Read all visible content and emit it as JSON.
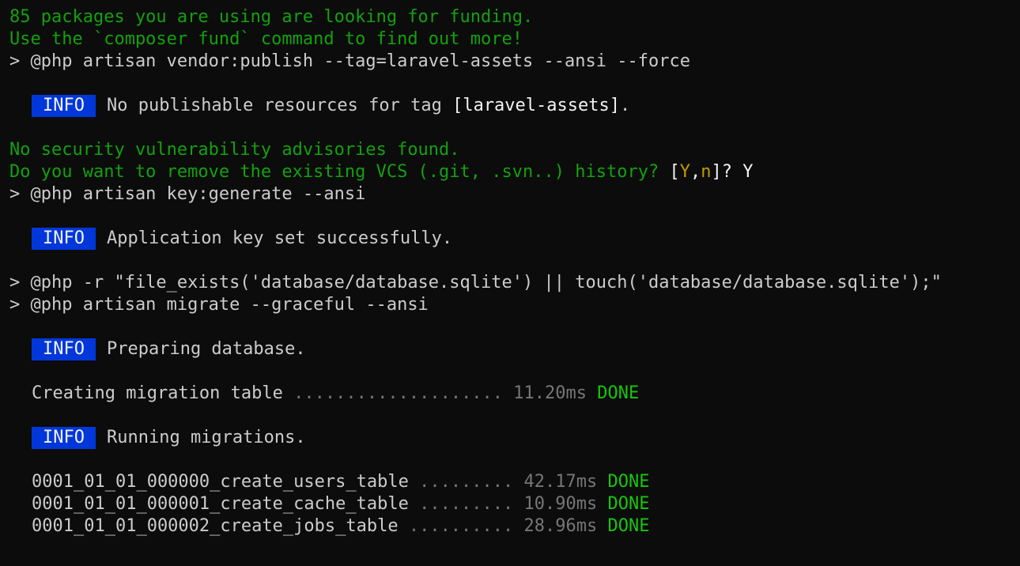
{
  "terminal": {
    "lines": {
      "funding_1": "85 packages you are using are looking for funding.",
      "funding_2": "Use the `composer fund` command to find out more!",
      "cmd_publish": "> @php artisan vendor:publish --tag=laravel-assets --ansi --force",
      "info_publish": {
        "badge": "INFO",
        "text_1": "No publishable resources for tag ",
        "text_2": "[laravel-assets]",
        "text_3": "."
      },
      "security": "No security vulnerability advisories found.",
      "vcs_prompt": {
        "question": "Do you want to remove the existing VCS (.git, .svn..) history? ",
        "bracket_open": "[",
        "opt_y": "Y",
        "comma": ",",
        "opt_n": "n",
        "bracket_close": "]",
        "suffix": "? ",
        "answer": "Y"
      },
      "cmd_keygen": "> @php artisan key:generate --ansi",
      "info_keygen": {
        "badge": "INFO",
        "text": "Application key set successfully."
      },
      "cmd_sqlite": "> @php -r \"file_exists('database/database.sqlite') || touch('database/database.sqlite');\"",
      "cmd_migrate": "> @php artisan migrate --graceful --ansi",
      "info_prepare": {
        "badge": "INFO",
        "text": "Preparing database."
      },
      "migration_table": {
        "name": "Creating migration table ",
        "dots": "....................",
        "time": "11.20ms",
        "status": "DONE"
      },
      "info_running": {
        "badge": "INFO",
        "text": "Running migrations."
      },
      "migrations": [
        {
          "name": "0001_01_01_000000_create_users_table ",
          "dots": ".........",
          "time": "42.17ms",
          "status": "DONE"
        },
        {
          "name": "0001_01_01_000001_create_cache_table ",
          "dots": ".........",
          "time": "10.90ms",
          "status": "DONE"
        },
        {
          "name": "0001_01_01_000002_create_jobs_table ",
          "dots": "..........",
          "time": "28.96ms",
          "status": "DONE"
        }
      ]
    },
    "colors": {
      "background": "#0c0c0c",
      "green": "#13a10e",
      "info_badge": "#0037da",
      "done": "#16c60c",
      "muted": "#767676",
      "yellow": "#c19c00"
    }
  }
}
